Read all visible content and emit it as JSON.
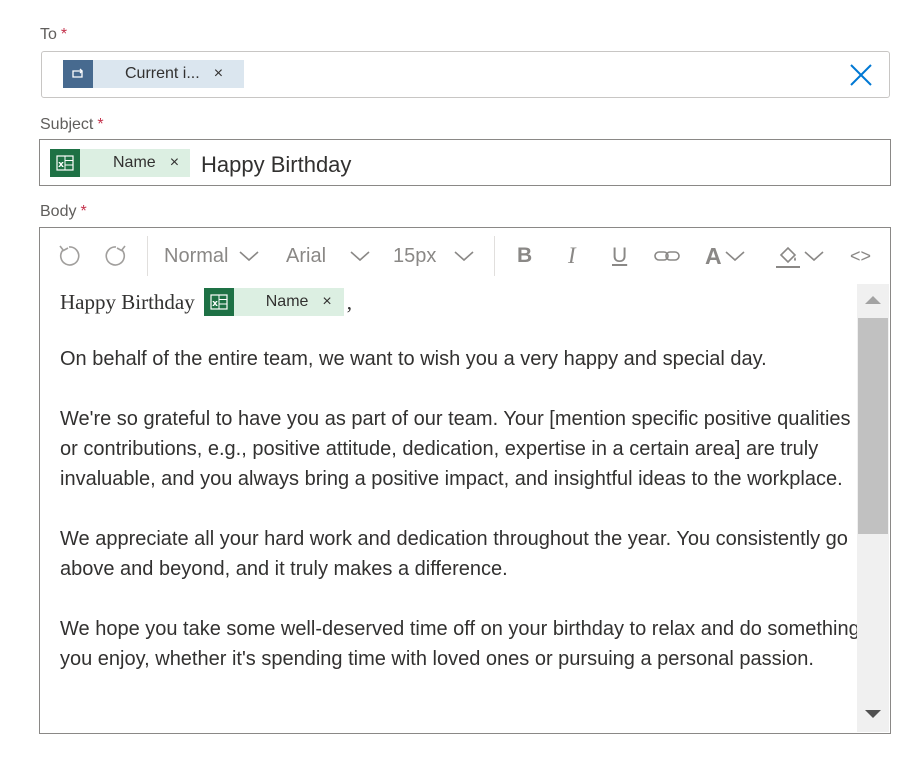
{
  "to": {
    "label": "To",
    "required": "*",
    "token_label": "Current i...",
    "token_remove": "×",
    "token_icon": "flow-icon",
    "clear_icon": "close-icon"
  },
  "subject": {
    "label": "Subject",
    "required": "*",
    "token_label": "Name",
    "token_remove": "×",
    "token_icon": "excel-icon",
    "text": "Happy Birthday"
  },
  "body": {
    "label": "Body",
    "required": "*",
    "toolbar": {
      "undo_icon": "undo-icon",
      "redo_icon": "redo-icon",
      "paragraph_style": "Normal",
      "font_family": "Arial",
      "font_size": "15px",
      "bold": "B",
      "italic": "I",
      "underline": "U",
      "link_icon": "link-icon",
      "font_color": "A",
      "highlight_icon": "highlight-icon",
      "code_view": "<>"
    },
    "greeting": "Happy Birthday",
    "greeting_token_label": "Name",
    "greeting_token_remove": "×",
    "greeting_suffix": ",",
    "paragraphs": [
      "On behalf of the entire team, we want to wish you a very happy and special day.",
      "We're so grateful to have you as part of our team. Your [mention specific positive qualities or contributions, e.g., positive attitude, dedication, expertise in a certain area] are truly invaluable, and you always bring a positive impact, and insightful ideas to the workplace.",
      "We appreciate all your hard work and dedication throughout the year. You consistently go above and beyond, and it truly makes a difference.",
      "We hope you take some well-deserved time off on your birthday to relax and do something you enjoy, whether it's spending time with loved ones or pursuing a personal passion."
    ]
  },
  "colors": {
    "excel_green": "#1e7145",
    "excel_token_bg": "#dcefe2",
    "flow_blue": "#476a8f",
    "flow_token_bg": "#dbe6ef",
    "required_red": "#c4314b",
    "clear_blue": "#0078d4"
  }
}
